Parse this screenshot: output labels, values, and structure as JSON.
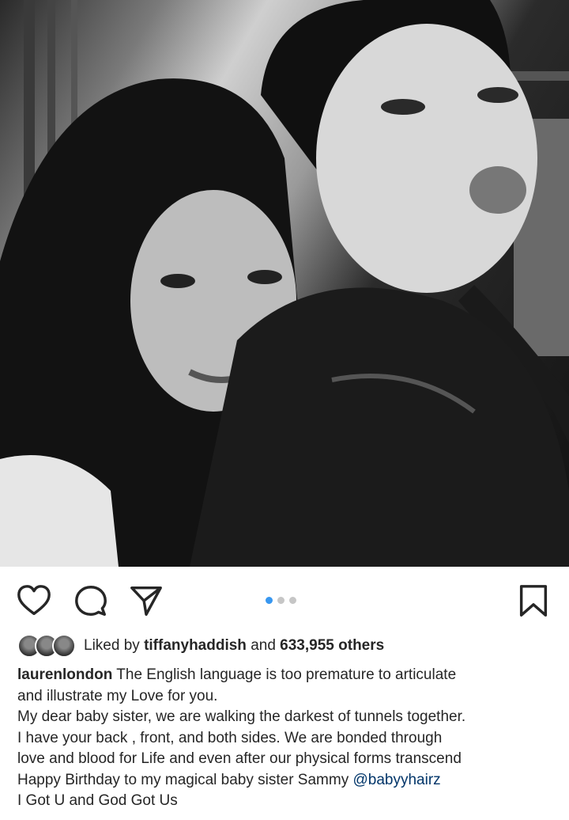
{
  "post": {
    "image_alt": "Black-and-white selfie of two women",
    "carousel": {
      "count": 3,
      "active_index": 0
    }
  },
  "actions": {
    "like_icon": "heart-icon",
    "comment_icon": "comment-icon",
    "share_icon": "send-icon",
    "save_icon": "bookmark-icon"
  },
  "likes": {
    "prefix": "Liked by",
    "user": "tiffanyhaddish",
    "conjunction": "and",
    "count": "633,955 others"
  },
  "caption": {
    "username": "laurenlondon",
    "line1": "The English language is too premature to articulate",
    "line2": "and illustrate my Love for you.",
    "line3": "My dear baby sister, we are walking the darkest of tunnels together.",
    "line4": "I have your back , front, and both sides. We are bonded through",
    "line5": "love and blood for Life and even after our physical forms transcend",
    "line6": "Happy Birthday to my magical baby sister Sammy",
    "mention": "@babyyhairz",
    "line7": "I Got U and God Got Us"
  },
  "colors": {
    "link": "#003569",
    "dot_active": "#3897f0",
    "dot_inactive": "#c6c6c6"
  }
}
